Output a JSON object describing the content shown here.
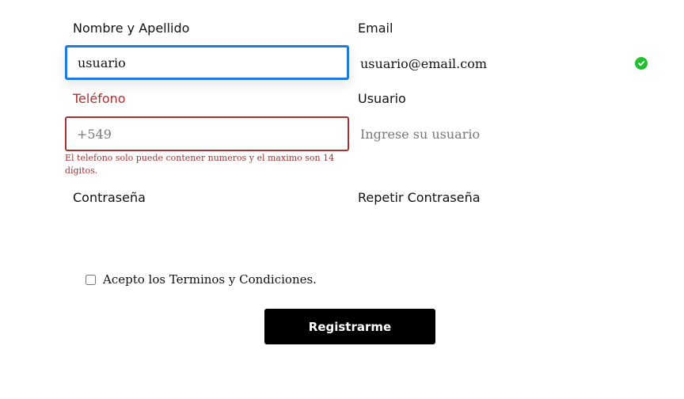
{
  "form": {
    "name": {
      "label": "Nombre y Apellido",
      "value": "usuario",
      "placeholder": ""
    },
    "email": {
      "label": "Email",
      "value": "usuario@email.com",
      "placeholder": "",
      "valid_icon": "check-circle-icon",
      "valid_color": "#22c02e"
    },
    "phone": {
      "label": "Teléfono",
      "value": "",
      "placeholder": "+549",
      "error": "El telefono solo puede contener numeros y el maximo son 14 dígitos.",
      "error_color": "#a83232"
    },
    "username": {
      "label": "Usuario",
      "value": "",
      "placeholder": "Ingrese su usuario"
    },
    "password": {
      "label": "Contraseña"
    },
    "repeat_password": {
      "label": "Repetir Contraseña"
    },
    "terms": {
      "label": "Acepto los Terminos y Condiciones.",
      "checked": false
    },
    "submit": {
      "label": "Registrarme"
    }
  },
  "colors": {
    "focus": "#1e7ae0",
    "error": "#a83232",
    "button_bg": "#000000"
  }
}
